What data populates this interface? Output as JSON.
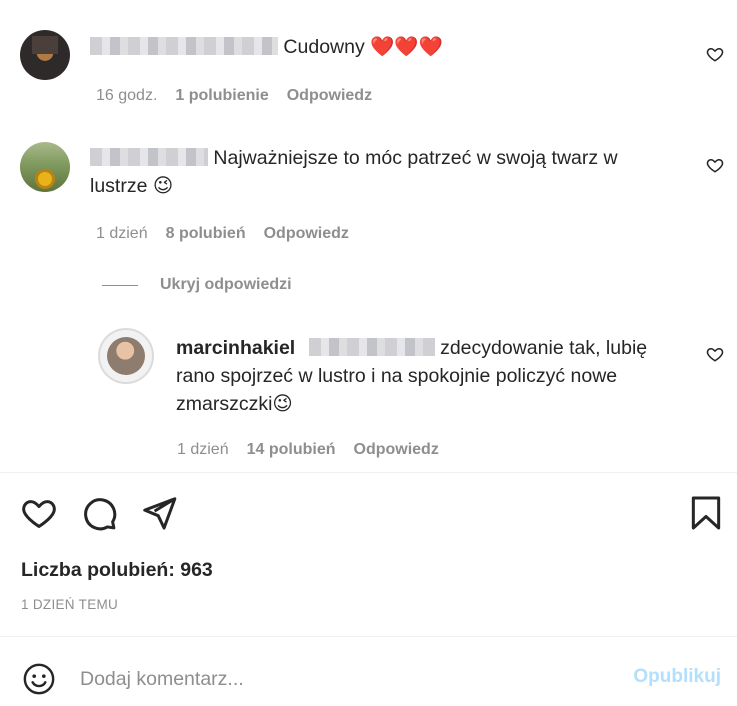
{
  "comments": [
    {
      "text": "Cudowny ❤️❤️❤️",
      "time": "16 godz.",
      "likes": "1 polubienie",
      "reply": "Odpowiedz"
    },
    {
      "text_line1": "Najważniejsze to móc patrzeć w swoją twarz w",
      "text_line2": "lustrze 😉",
      "time": "1 dzień",
      "likes": "8 polubień",
      "reply": "Odpowiedz"
    }
  ],
  "replies_toggle": "Ukryj odpowiedzi",
  "reply_comment": {
    "username": "marcinhakiel",
    "text_line1": "zdecydowanie tak, lubię",
    "text_line2": "rano spojrzeć w lustro i na spokojnie policzyć nowe",
    "text_line3": "zmarszczki😉",
    "time": "1 dzień",
    "likes": "14 polubień",
    "reply": "Odpowiedz"
  },
  "post": {
    "likes_label": "Liczba polubień: 963",
    "date": "1 DZIEŃ TEMU"
  },
  "compose": {
    "placeholder": "Dodaj komentarz...",
    "publish_label": "Opublikuj"
  },
  "colors": {
    "text": "#262626",
    "muted": "#8e8e8e",
    "publish_disabled": "#b2dffc",
    "divider": "#efefef"
  },
  "icons": [
    "heart-icon",
    "comment-icon",
    "share-icon",
    "bookmark-icon",
    "emoji-icon"
  ]
}
